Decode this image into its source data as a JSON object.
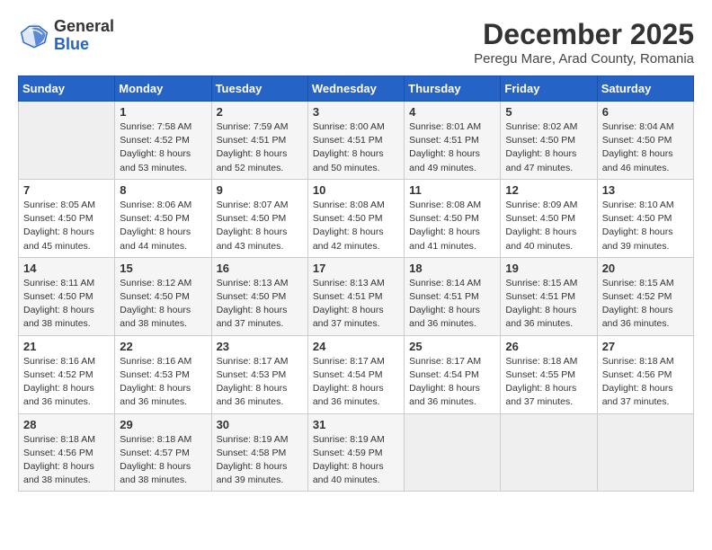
{
  "header": {
    "logo_general": "General",
    "logo_blue": "Blue",
    "month_title": "December 2025",
    "subtitle": "Peregu Mare, Arad County, Romania"
  },
  "weekdays": [
    "Sunday",
    "Monday",
    "Tuesday",
    "Wednesday",
    "Thursday",
    "Friday",
    "Saturday"
  ],
  "weeks": [
    [
      {
        "day": "",
        "info": ""
      },
      {
        "day": "1",
        "info": "Sunrise: 7:58 AM\nSunset: 4:52 PM\nDaylight: 8 hours\nand 53 minutes."
      },
      {
        "day": "2",
        "info": "Sunrise: 7:59 AM\nSunset: 4:51 PM\nDaylight: 8 hours\nand 52 minutes."
      },
      {
        "day": "3",
        "info": "Sunrise: 8:00 AM\nSunset: 4:51 PM\nDaylight: 8 hours\nand 50 minutes."
      },
      {
        "day": "4",
        "info": "Sunrise: 8:01 AM\nSunset: 4:51 PM\nDaylight: 8 hours\nand 49 minutes."
      },
      {
        "day": "5",
        "info": "Sunrise: 8:02 AM\nSunset: 4:50 PM\nDaylight: 8 hours\nand 47 minutes."
      },
      {
        "day": "6",
        "info": "Sunrise: 8:04 AM\nSunset: 4:50 PM\nDaylight: 8 hours\nand 46 minutes."
      }
    ],
    [
      {
        "day": "7",
        "info": "Sunrise: 8:05 AM\nSunset: 4:50 PM\nDaylight: 8 hours\nand 45 minutes."
      },
      {
        "day": "8",
        "info": "Sunrise: 8:06 AM\nSunset: 4:50 PM\nDaylight: 8 hours\nand 44 minutes."
      },
      {
        "day": "9",
        "info": "Sunrise: 8:07 AM\nSunset: 4:50 PM\nDaylight: 8 hours\nand 43 minutes."
      },
      {
        "day": "10",
        "info": "Sunrise: 8:08 AM\nSunset: 4:50 PM\nDaylight: 8 hours\nand 42 minutes."
      },
      {
        "day": "11",
        "info": "Sunrise: 8:08 AM\nSunset: 4:50 PM\nDaylight: 8 hours\nand 41 minutes."
      },
      {
        "day": "12",
        "info": "Sunrise: 8:09 AM\nSunset: 4:50 PM\nDaylight: 8 hours\nand 40 minutes."
      },
      {
        "day": "13",
        "info": "Sunrise: 8:10 AM\nSunset: 4:50 PM\nDaylight: 8 hours\nand 39 minutes."
      }
    ],
    [
      {
        "day": "14",
        "info": "Sunrise: 8:11 AM\nSunset: 4:50 PM\nDaylight: 8 hours\nand 38 minutes."
      },
      {
        "day": "15",
        "info": "Sunrise: 8:12 AM\nSunset: 4:50 PM\nDaylight: 8 hours\nand 38 minutes."
      },
      {
        "day": "16",
        "info": "Sunrise: 8:13 AM\nSunset: 4:50 PM\nDaylight: 8 hours\nand 37 minutes."
      },
      {
        "day": "17",
        "info": "Sunrise: 8:13 AM\nSunset: 4:51 PM\nDaylight: 8 hours\nand 37 minutes."
      },
      {
        "day": "18",
        "info": "Sunrise: 8:14 AM\nSunset: 4:51 PM\nDaylight: 8 hours\nand 36 minutes."
      },
      {
        "day": "19",
        "info": "Sunrise: 8:15 AM\nSunset: 4:51 PM\nDaylight: 8 hours\nand 36 minutes."
      },
      {
        "day": "20",
        "info": "Sunrise: 8:15 AM\nSunset: 4:52 PM\nDaylight: 8 hours\nand 36 minutes."
      }
    ],
    [
      {
        "day": "21",
        "info": "Sunrise: 8:16 AM\nSunset: 4:52 PM\nDaylight: 8 hours\nand 36 minutes."
      },
      {
        "day": "22",
        "info": "Sunrise: 8:16 AM\nSunset: 4:53 PM\nDaylight: 8 hours\nand 36 minutes."
      },
      {
        "day": "23",
        "info": "Sunrise: 8:17 AM\nSunset: 4:53 PM\nDaylight: 8 hours\nand 36 minutes."
      },
      {
        "day": "24",
        "info": "Sunrise: 8:17 AM\nSunset: 4:54 PM\nDaylight: 8 hours\nand 36 minutes."
      },
      {
        "day": "25",
        "info": "Sunrise: 8:17 AM\nSunset: 4:54 PM\nDaylight: 8 hours\nand 36 minutes."
      },
      {
        "day": "26",
        "info": "Sunrise: 8:18 AM\nSunset: 4:55 PM\nDaylight: 8 hours\nand 37 minutes."
      },
      {
        "day": "27",
        "info": "Sunrise: 8:18 AM\nSunset: 4:56 PM\nDaylight: 8 hours\nand 37 minutes."
      }
    ],
    [
      {
        "day": "28",
        "info": "Sunrise: 8:18 AM\nSunset: 4:56 PM\nDaylight: 8 hours\nand 38 minutes."
      },
      {
        "day": "29",
        "info": "Sunrise: 8:18 AM\nSunset: 4:57 PM\nDaylight: 8 hours\nand 38 minutes."
      },
      {
        "day": "30",
        "info": "Sunrise: 8:19 AM\nSunset: 4:58 PM\nDaylight: 8 hours\nand 39 minutes."
      },
      {
        "day": "31",
        "info": "Sunrise: 8:19 AM\nSunset: 4:59 PM\nDaylight: 8 hours\nand 40 minutes."
      },
      {
        "day": "",
        "info": ""
      },
      {
        "day": "",
        "info": ""
      },
      {
        "day": "",
        "info": ""
      }
    ]
  ]
}
